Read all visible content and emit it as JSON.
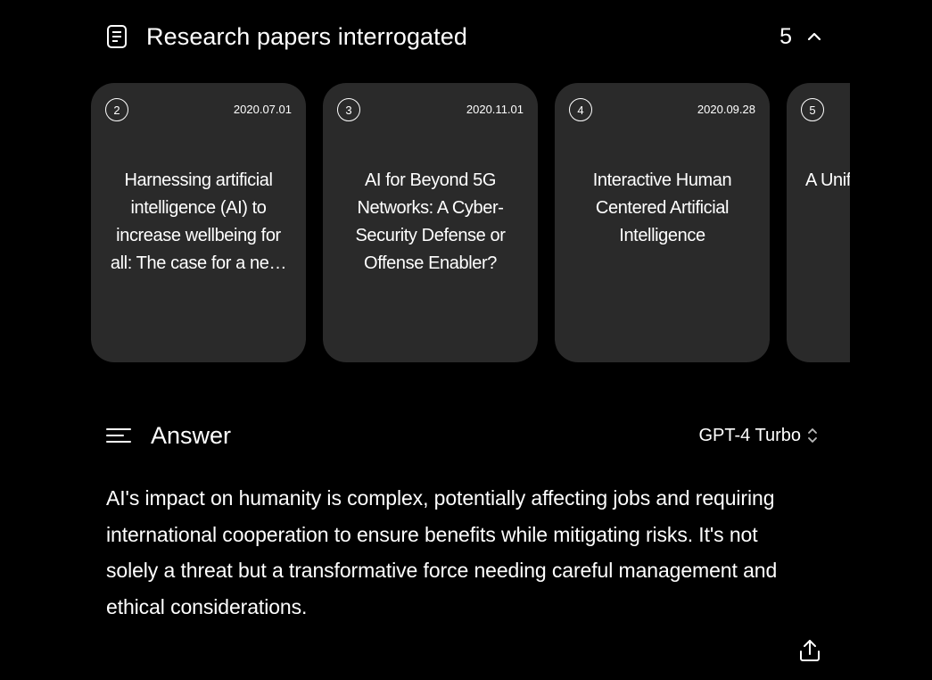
{
  "papers": {
    "title": "Research papers interrogated",
    "count": "5",
    "cards": [
      {
        "num": "2",
        "date": "2020.07.01",
        "title": "Harnessing artificial intelligence (AI) to increase wellbeing for all: The case for a ne…"
      },
      {
        "num": "3",
        "date": "2020.11.01",
        "title": "AI for Beyond 5G Networks: A Cyber-Security Defense or Offense Enabler?"
      },
      {
        "num": "4",
        "date": "2020.09.28",
        "title": "Interactive Human Centered Artificial Intelligence"
      },
      {
        "num": "5",
        "date": "",
        "title": "A Unified Framework of Five"
      }
    ]
  },
  "answer": {
    "title": "Answer",
    "model": "GPT-4 Turbo",
    "text": "AI's impact on humanity is complex, potentially affecting jobs and requiring international cooperation to ensure benefits while mitigating risks. It's not solely a threat but a transformative force needing careful management and ethical considerations."
  },
  "icons": {
    "papers": "document-icon",
    "collapse": "chevron-up-icon",
    "answer": "lines-icon",
    "model": "up-down-chevron-icon",
    "share": "share-icon"
  }
}
